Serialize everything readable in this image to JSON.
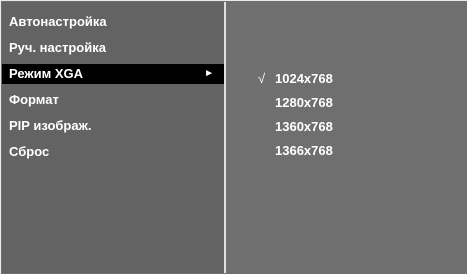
{
  "main_menu": {
    "items": [
      {
        "label": "Автонастройка"
      },
      {
        "label": "Руч. настройка"
      },
      {
        "label": "Режим XGA",
        "selected": true,
        "arrow": "►"
      },
      {
        "label": "Формат"
      },
      {
        "label": "PIP изображ."
      },
      {
        "label": "Сброс"
      }
    ]
  },
  "submenu": {
    "check_mark": "√",
    "checked_index": 0,
    "items": [
      {
        "label": "1024x768"
      },
      {
        "label": "1280x768"
      },
      {
        "label": "1360x768"
      },
      {
        "label": "1366x768"
      }
    ]
  },
  "colors": {
    "panel_bg": "#6f6f6f",
    "menu_bg": "#636363",
    "highlight_bg": "#000000",
    "text": "#ffffff",
    "border": "#e0e0e0"
  }
}
